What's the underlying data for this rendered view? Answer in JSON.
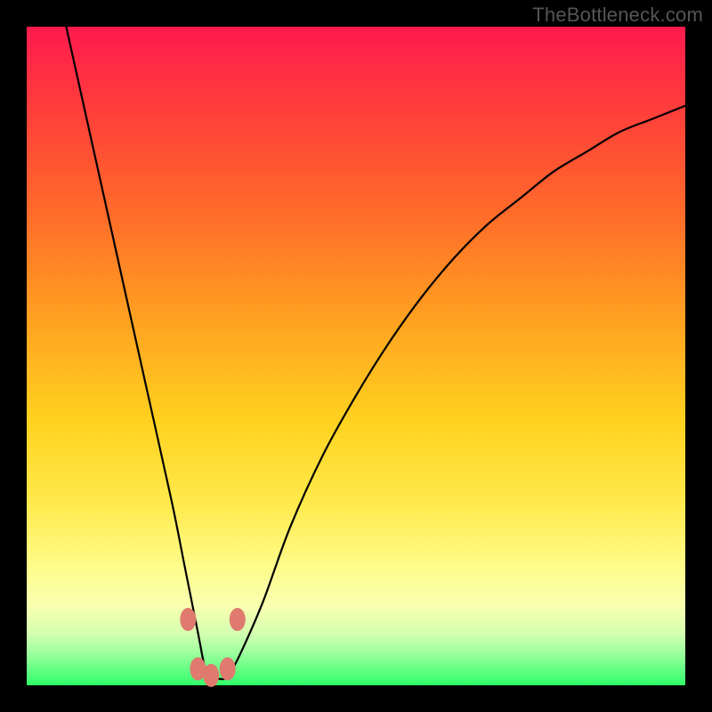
{
  "watermark": "TheBottleneck.com",
  "chart_data": {
    "type": "line",
    "title": "",
    "xlabel": "",
    "ylabel": "",
    "xlim": [
      0,
      100
    ],
    "ylim": [
      0,
      100
    ],
    "legend": false,
    "grid": false,
    "note": "V-shaped bottleneck curve over red→green vertical gradient. Lower y = better (green). Curve bottoms out near x≈26–31 at y≈1. Values are estimated from pixel positions (no axis ticks shown).",
    "series": [
      {
        "name": "bottleneck-curve",
        "x": [
          6,
          10,
          14,
          18,
          22,
          24,
          26,
          27,
          28,
          29,
          30,
          31,
          33,
          36,
          40,
          45,
          50,
          55,
          60,
          65,
          70,
          75,
          80,
          85,
          90,
          95,
          100
        ],
        "y": [
          100,
          82,
          64,
          46,
          28,
          18,
          8,
          3,
          1,
          1,
          1,
          2,
          6,
          13,
          24,
          35,
          44,
          52,
          59,
          65,
          70,
          74,
          78,
          81,
          84,
          86,
          88
        ]
      }
    ],
    "markers": [
      {
        "x": 24.5,
        "y": 10
      },
      {
        "x": 32.0,
        "y": 10
      },
      {
        "x": 26.0,
        "y": 2.5
      },
      {
        "x": 28.0,
        "y": 1.5
      },
      {
        "x": 30.5,
        "y": 2.5
      }
    ]
  }
}
